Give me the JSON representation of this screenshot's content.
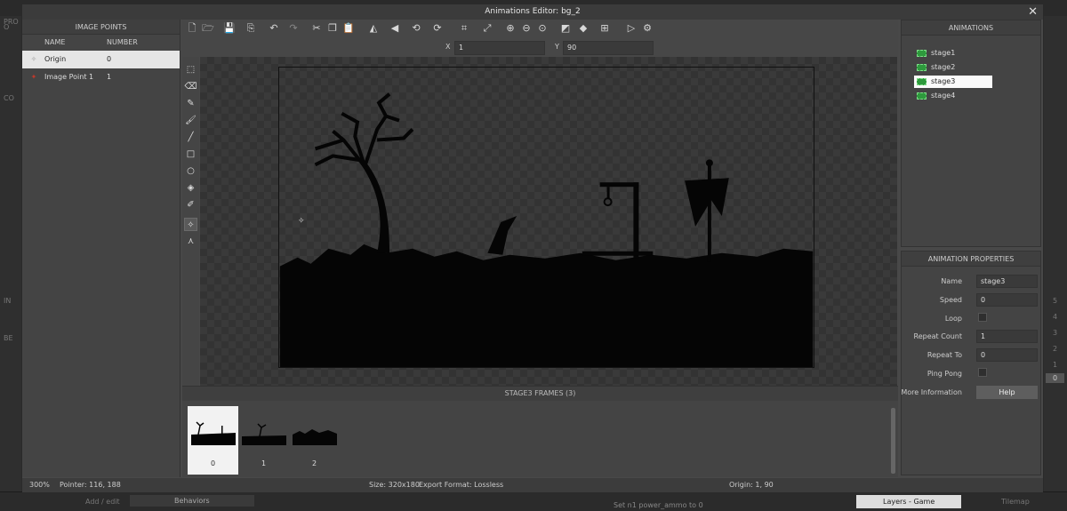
{
  "background_app": {
    "left_labels": [
      "PRO",
      "O",
      "CO",
      "IN",
      "BE"
    ],
    "bottom": {
      "add_edit": "Add / edit",
      "behaviors": "Behaviors",
      "layers_tab": "Layers - Game",
      "tilemap_tab": "Tilemap",
      "snippet": "Set n1 power_ammo to 0"
    },
    "right_numbers": [
      "5",
      "4",
      "3",
      "2",
      "1",
      "0"
    ]
  },
  "dialog": {
    "title": "Animations Editor: bg_2"
  },
  "image_points": {
    "header": "IMAGE POINTS",
    "columns": [
      "NAME",
      "NUMBER"
    ],
    "rows": [
      {
        "name": "Origin",
        "number": "0",
        "selected": true
      },
      {
        "name": "Image Point 1",
        "number": "1",
        "selected": false
      }
    ]
  },
  "toolbar": {
    "icons": [
      "new-file",
      "open-folder",
      "save",
      "export",
      "undo",
      "redo",
      "cut",
      "copy",
      "paste",
      "flip-horizontal",
      "flip-vertical",
      "rotate-ccw",
      "rotate-cw",
      "crop",
      "resize",
      "zoom-in",
      "zoom-out",
      "zoom-reset",
      "toggle-background",
      "layers",
      "grid",
      "play",
      "settings"
    ]
  },
  "coords": {
    "x_label": "X",
    "x_value": "1",
    "y_label": "Y",
    "y_value": "90"
  },
  "frames": {
    "header": "STAGE3 FRAMES (3)",
    "items": [
      "0",
      "1",
      "2"
    ],
    "selected_index": 0
  },
  "status": {
    "zoom": "300%",
    "pointer": "Pointer: 116, 188",
    "size": "Size: 320x180",
    "export": "Export Format: Lossless",
    "origin": "Origin: 1, 90"
  },
  "animations": {
    "header": "ANIMATIONS",
    "items": [
      "stage1",
      "stage2",
      "stage3",
      "stage4"
    ],
    "selected": "stage3"
  },
  "properties": {
    "header": "ANIMATION PROPERTIES",
    "name_label": "Name",
    "name_value": "stage3",
    "speed_label": "Speed",
    "speed_value": "0",
    "loop_label": "Loop",
    "repeat_count_label": "Repeat Count",
    "repeat_count_value": "1",
    "repeat_to_label": "Repeat To",
    "repeat_to_value": "0",
    "ping_pong_label": "Ping Pong",
    "more_info_label": "More Information",
    "help_label": "Help"
  },
  "colors": {
    "accent_green": "#2e9a3d",
    "image_point_red": "#c0392b",
    "selection": "#e6e6e6"
  }
}
